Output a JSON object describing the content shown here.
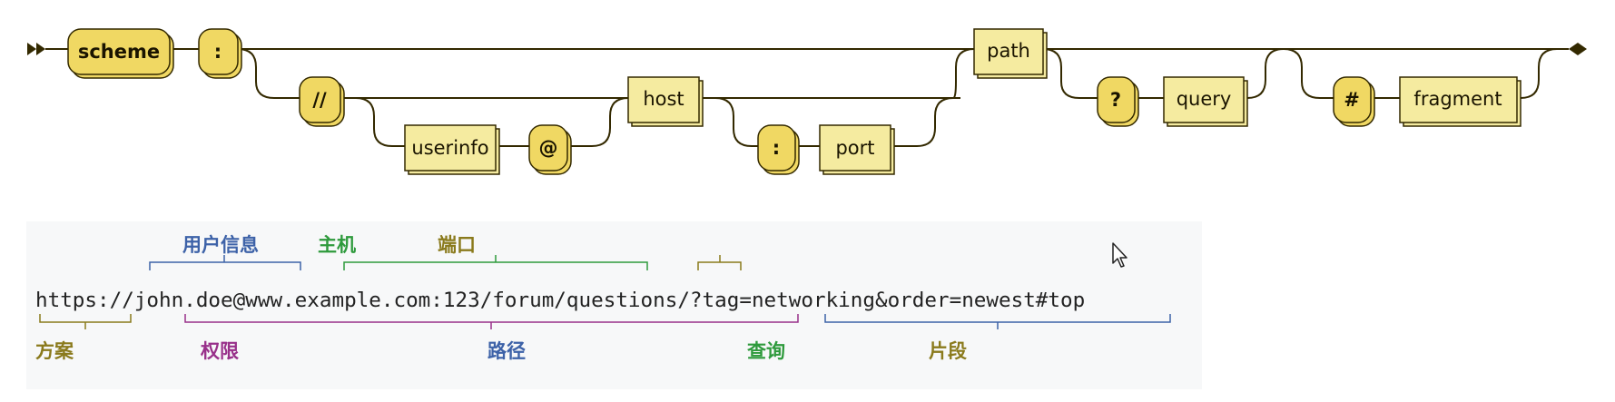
{
  "syntax_diagram": {
    "terminals": {
      "scheme": "scheme",
      "colon": ":",
      "slashes": "//",
      "at": "@",
      "port_colon": ":",
      "question": "?",
      "hash": "#"
    },
    "nonterminals": {
      "userinfo": "userinfo",
      "host": "host",
      "port": "port",
      "path": "path",
      "query": "query",
      "fragment": "fragment"
    }
  },
  "url_example": {
    "url": "https://john.doe@www.example.com:123/forum/questions/?tag=networking&order=newest#top",
    "labels": {
      "userinfo": "用户信息",
      "host": "主机",
      "port": "端口",
      "scheme": "方案",
      "authority": "权限",
      "path": "路径",
      "query": "查询",
      "fragment": "片段"
    },
    "colors": {
      "scheme": "#8a7a1c",
      "userinfo": "#3d62a8",
      "host": "#2e9a3c",
      "port": "#8a7a1c",
      "authority": "#98308a",
      "path": "#3d62a8",
      "query": "#2e9a3c",
      "fragment": "#8a7a1c"
    }
  }
}
